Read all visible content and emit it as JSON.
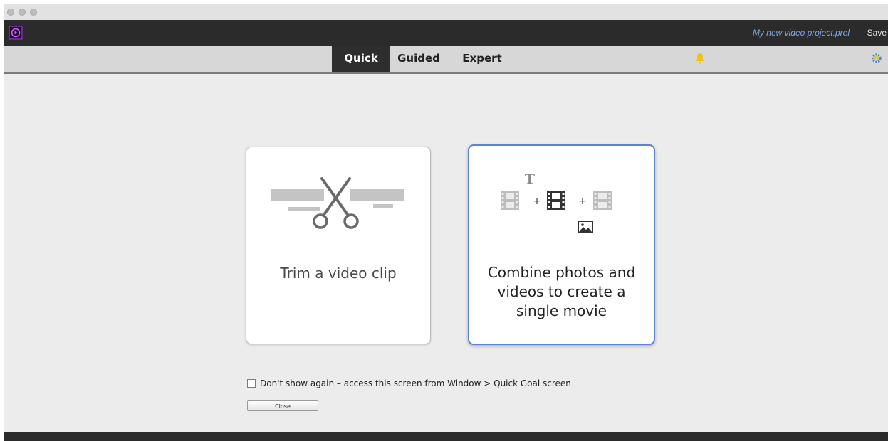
{
  "window": {
    "project_name": "My new video project.prel",
    "save_label": "Save"
  },
  "modes": {
    "tabs": [
      {
        "label": "Quick",
        "active": true
      },
      {
        "label": "Guided",
        "active": false
      },
      {
        "label": "Expert",
        "active": false
      }
    ]
  },
  "icons": {
    "bell": "bell-icon",
    "gear": "gear-icon",
    "scissors": "scissors-icon",
    "combine": "combine-media-icon"
  },
  "colors": {
    "app_bar": "#2b2b2b",
    "accent_blue": "#5b82d4",
    "bell_yellow": "#f0c419",
    "project_name": "#7ea9e6"
  },
  "goals": {
    "trim_label": "Trim a video clip",
    "combine_label_lines": [
      "Combine photos and",
      "videos to create a",
      "single movie"
    ],
    "combine_icon_text": "T"
  },
  "footer": {
    "dont_show_label": "Don't show again – access this screen from Window > Quick Goal screen",
    "close_label": "Close"
  }
}
